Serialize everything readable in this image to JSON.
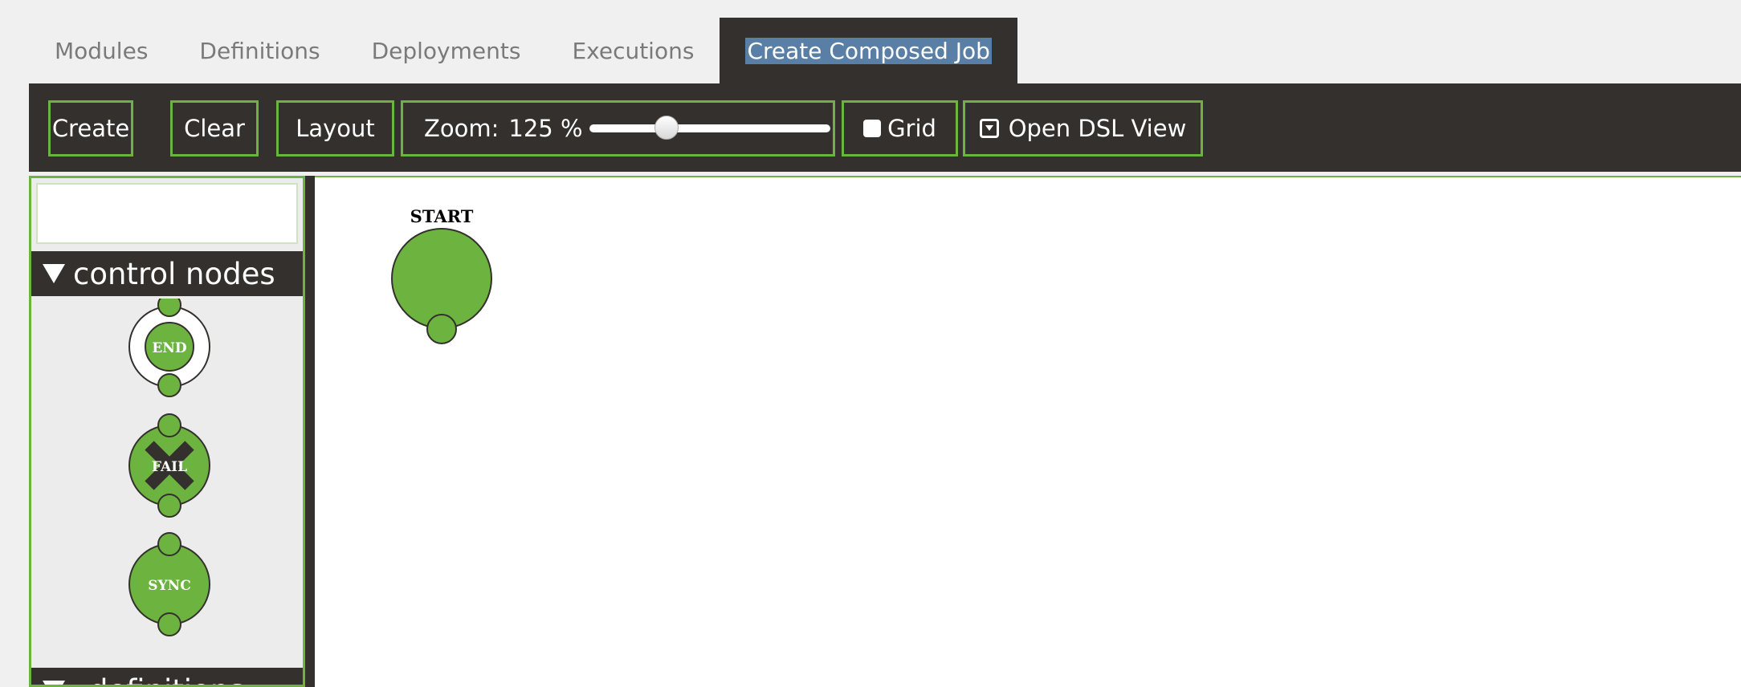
{
  "tabs": [
    {
      "label": "Modules"
    },
    {
      "label": "Definitions"
    },
    {
      "label": "Deployments"
    },
    {
      "label": "Executions"
    },
    {
      "label": "Create Composed Job"
    }
  ],
  "active_tab_index": 4,
  "toolbar": {
    "create_label": "Create",
    "clear_label": "Clear",
    "layout_label": "Layout",
    "zoom_label": "Zoom:",
    "zoom_value": "125 %",
    "zoom_slider_fraction": 0.32,
    "grid_label": "Grid",
    "grid_checked": false,
    "open_dsl_label": "Open DSL View"
  },
  "palette": {
    "search_value": "",
    "groups": [
      {
        "label": "control nodes"
      },
      {
        "label": "definitions"
      }
    ],
    "control_nodes": [
      {
        "label": "END"
      },
      {
        "label": "FAIL"
      },
      {
        "label": "SYNC"
      }
    ]
  },
  "canvas": {
    "nodes": [
      {
        "label": "START"
      }
    ]
  },
  "colors": {
    "accent_green": "#6db33f",
    "dark_bar": "#34302d",
    "tab_text": "#7a7a7a",
    "selection": "#5a7fa6"
  }
}
